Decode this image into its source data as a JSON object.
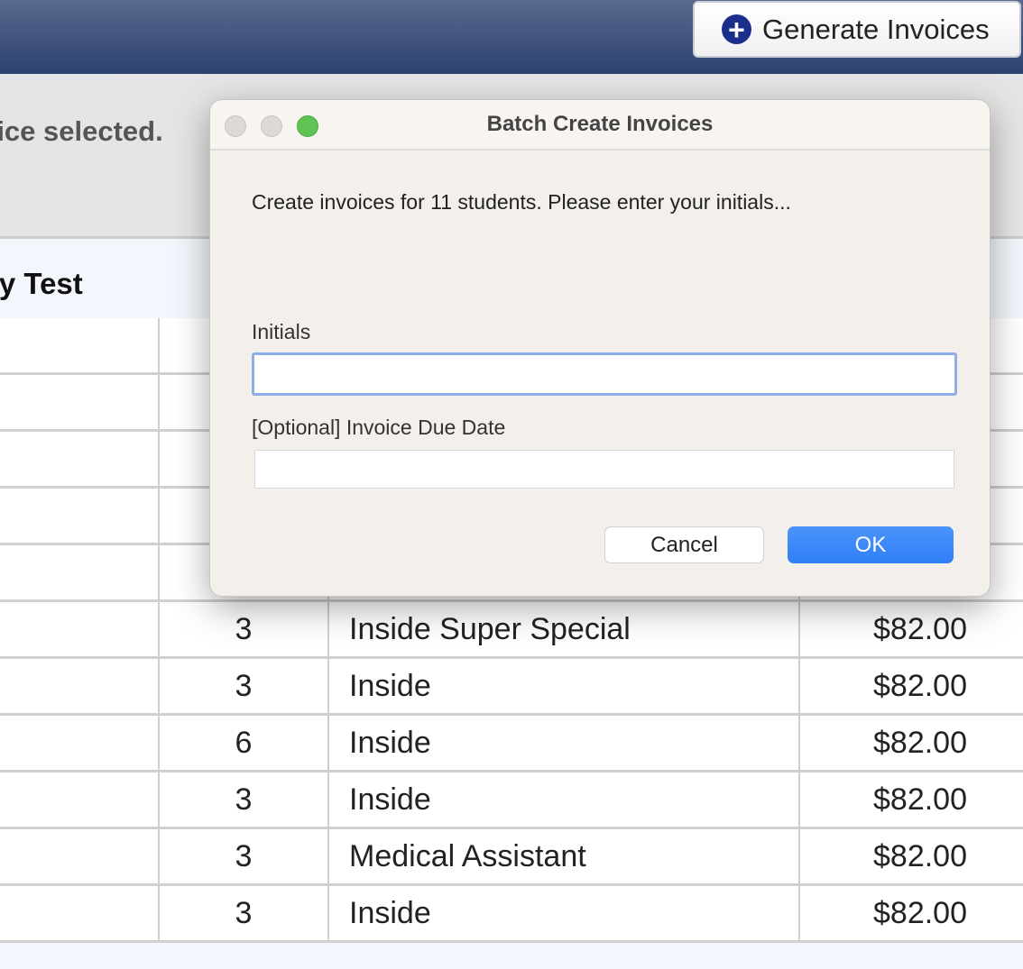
{
  "header": {
    "generate_label": "Generate Invoices",
    "generate_icon": "plus-circle-icon"
  },
  "toolbar": {
    "selection_text": "tice selected."
  },
  "table": {
    "column_title": "ry Test",
    "rows": [
      {
        "num": "",
        "type": "",
        "price": ""
      },
      {
        "num": "",
        "type": "",
        "price": ""
      },
      {
        "num": "",
        "type": "",
        "price": ""
      },
      {
        "num": "",
        "type": "",
        "price": ""
      },
      {
        "num": "",
        "type": "",
        "price": ""
      },
      {
        "num": "3",
        "type": "Inside Super Special",
        "price": "$82.00"
      },
      {
        "num": "3",
        "type": "Inside",
        "price": "$82.00"
      },
      {
        "num": "6",
        "type": "Inside",
        "price": "$82.00"
      },
      {
        "num": "3",
        "type": "Inside",
        "price": "$82.00"
      },
      {
        "num": "3",
        "type": "Medical Assistant",
        "price": "$82.00"
      },
      {
        "num": "3",
        "type": "Inside",
        "price": "$82.00"
      }
    ]
  },
  "dialog": {
    "title": "Batch Create Invoices",
    "message": "Create invoices for 11 students.  Please enter your initials...",
    "initials_label": "Initials",
    "initials_value": "",
    "due_label": "[Optional] Invoice Due Date",
    "due_value": "",
    "cancel_label": "Cancel",
    "ok_label": "OK",
    "accent": "#2f7ef5"
  }
}
